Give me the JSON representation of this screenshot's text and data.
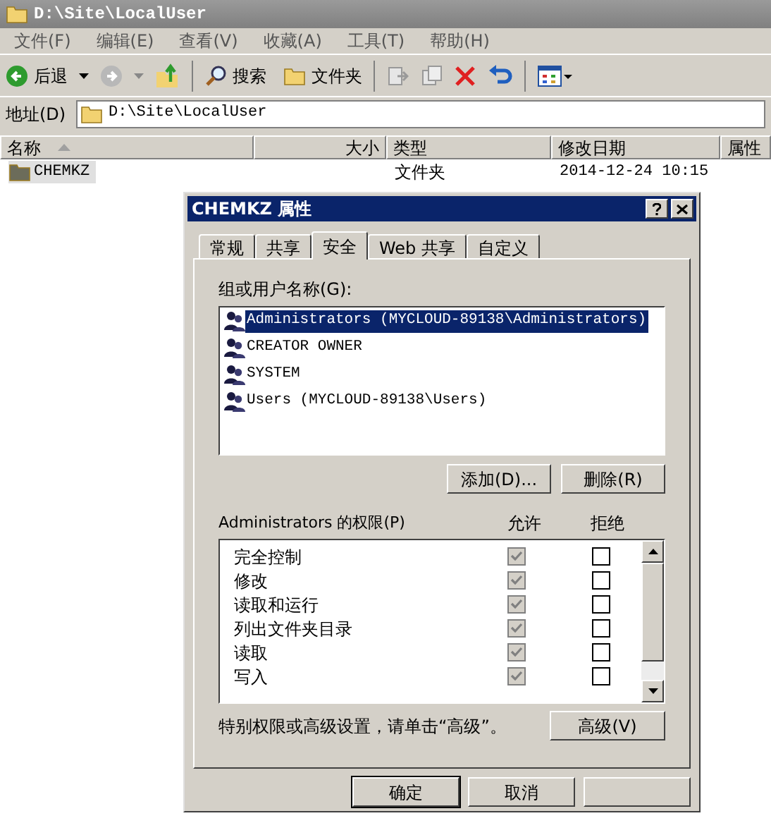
{
  "window": {
    "title": "D:\\Site\\LocalUser"
  },
  "menu": [
    "文件(F)",
    "编辑(E)",
    "查看(V)",
    "收藏(A)",
    "工具(T)",
    "帮助(H)"
  ],
  "toolbar": {
    "back": "后退",
    "search": "搜索",
    "folders": "文件夹"
  },
  "address": {
    "label": "地址(D)",
    "value": "D:\\Site\\LocalUser"
  },
  "columns": [
    {
      "label": "名称",
      "sorted": true
    },
    {
      "label": "大小",
      "sorted": false
    },
    {
      "label": "类型",
      "sorted": false
    },
    {
      "label": "修改日期",
      "sorted": false
    },
    {
      "label": "属性",
      "sorted": false
    }
  ],
  "rows": [
    {
      "name": "CHEMKZ",
      "type": "文件夹",
      "modified": "2014-12-24 10:15",
      "selected": true
    }
  ],
  "dialog": {
    "title": "CHEMKZ 属性",
    "tabs": [
      {
        "label": "常规",
        "selected": false
      },
      {
        "label": "共享",
        "selected": false
      },
      {
        "label": "安全",
        "selected": true
      },
      {
        "label": "Web 共享",
        "selected": false
      },
      {
        "label": "自定义",
        "selected": false
      }
    ],
    "group_label": "组或用户名称(G):",
    "users": [
      {
        "name": "Administrators (MYCLOUD-89138\\Administrators)",
        "selected": true
      },
      {
        "name": "CREATOR OWNER",
        "selected": false
      },
      {
        "name": "SYSTEM",
        "selected": false
      },
      {
        "name": "Users (MYCLOUD-89138\\Users)",
        "selected": false
      }
    ],
    "add_button": "添加(D)...",
    "remove_button": "删除(R)",
    "permissions_label": "Administrators 的权限(P)",
    "allow_header": "允许",
    "deny_header": "拒绝",
    "permissions": [
      {
        "name": "完全控制",
        "allow": true,
        "allow_disabled": true,
        "deny": false
      },
      {
        "name": "修改",
        "allow": true,
        "allow_disabled": true,
        "deny": false
      },
      {
        "name": "读取和运行",
        "allow": true,
        "allow_disabled": true,
        "deny": false
      },
      {
        "name": "列出文件夹目录",
        "allow": true,
        "allow_disabled": true,
        "deny": false
      },
      {
        "name": "读取",
        "allow": true,
        "allow_disabled": true,
        "deny": false
      },
      {
        "name": "写入",
        "allow": true,
        "allow_disabled": true,
        "deny": false
      }
    ],
    "advanced_hint": "特别权限或高级设置，请单击“高级”。",
    "advanced_button": "高级(V)",
    "buttons": [
      "确定",
      "取消"
    ]
  }
}
